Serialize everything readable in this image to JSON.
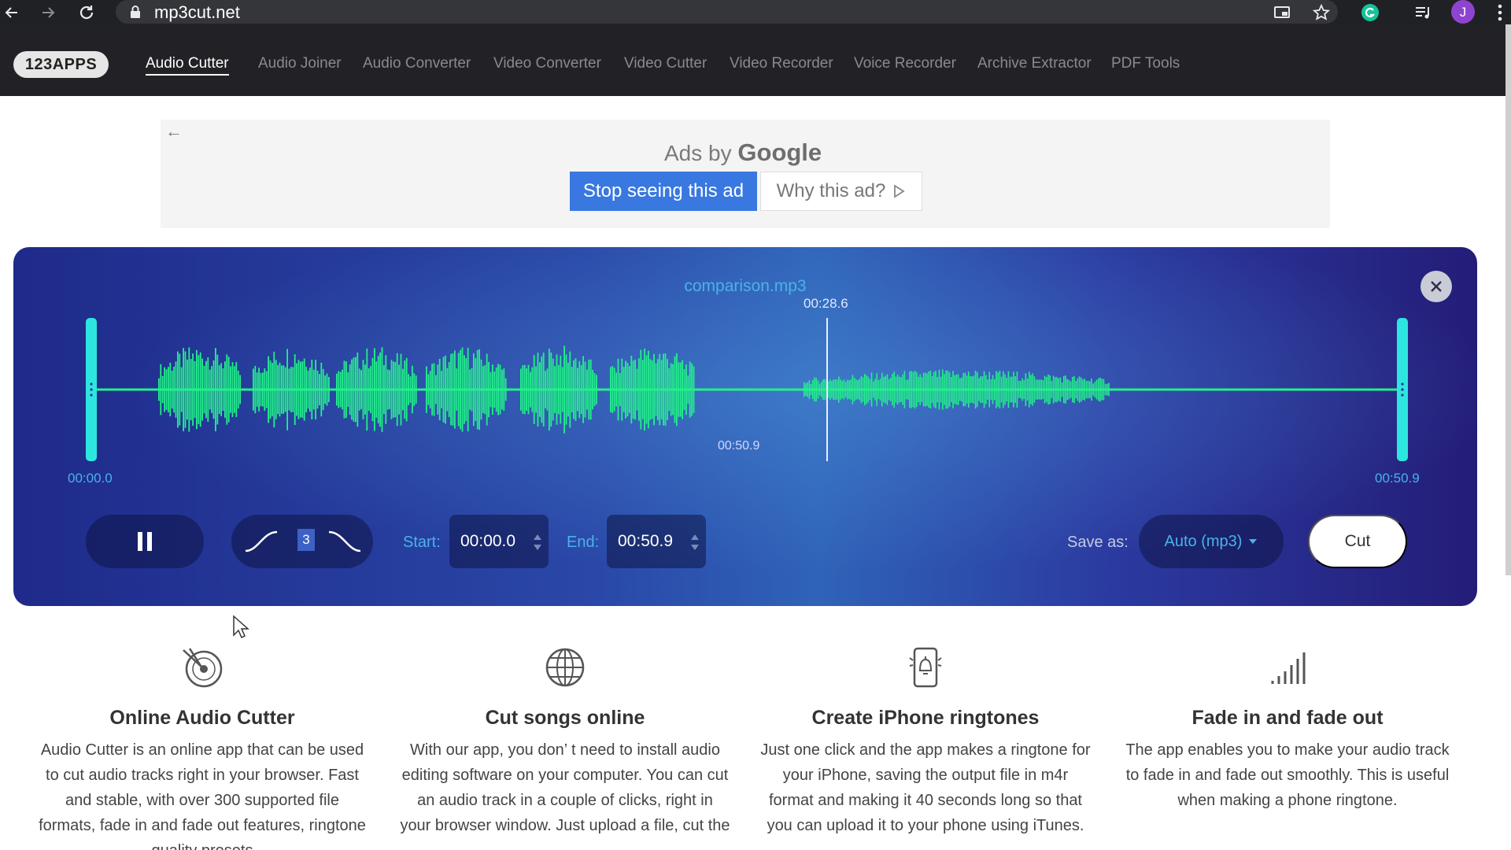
{
  "browser": {
    "url": "mp3cut.net",
    "profile_initial": "J"
  },
  "nav": {
    "logo": "123APPS",
    "items": [
      {
        "label": "Audio Cutter",
        "active": true
      },
      {
        "label": "Audio Joiner"
      },
      {
        "label": "Audio Converter"
      },
      {
        "label": "Video Converter"
      },
      {
        "label": "Video Cutter"
      },
      {
        "label": "Video Recorder"
      },
      {
        "label": "Voice Recorder"
      },
      {
        "label": "Archive Extractor"
      },
      {
        "label": "PDF Tools"
      }
    ]
  },
  "ad": {
    "ads_by": "Ads by",
    "brand": "Google",
    "stop_label": "Stop seeing this ad",
    "why_label": "Why this ad?"
  },
  "editor": {
    "filename": "comparison.mp3",
    "playhead_time": "00:28.6",
    "inner_end_time": "00:50.9",
    "start_marker": "00:00.0",
    "end_marker": "00:50.9",
    "fade_value": "3",
    "start_label": "Start:",
    "start_value": "00:00.0",
    "end_label": "End:",
    "end_value": "00:50.9",
    "save_as_label": "Save as:",
    "format": "Auto (mp3)",
    "cut_label": "Cut",
    "accent_color": "#22f08a",
    "handle_color": "#2ee6e0"
  },
  "features": [
    {
      "icon": "vinyl-scissors-icon",
      "title": "Online Audio Cutter",
      "text": "Audio Cutter is an online app that can be used to cut audio tracks right in your browser. Fast and stable, with over 300 supported file formats, fade in and fade out features, ringtone quality presets"
    },
    {
      "icon": "globe-icon",
      "title": "Cut songs online",
      "text": "With our app, you don’ t need to install audio editing software on your computer. You can cut an audio track in a couple of clicks, right in your browser window. Just upload a file, cut the"
    },
    {
      "icon": "phone-bell-icon",
      "title": "Create iPhone ringtones",
      "text": "Just one click and the app makes a ringtone for your iPhone, saving the output file in m4r format and making it 40 seconds long so that you can upload it to your phone using iTunes."
    },
    {
      "icon": "signal-bars-icon",
      "title": "Fade in and fade out",
      "text": "The app enables you to make your audio track to fade in and fade out smoothly. This is useful when making a phone ringtone."
    }
  ]
}
